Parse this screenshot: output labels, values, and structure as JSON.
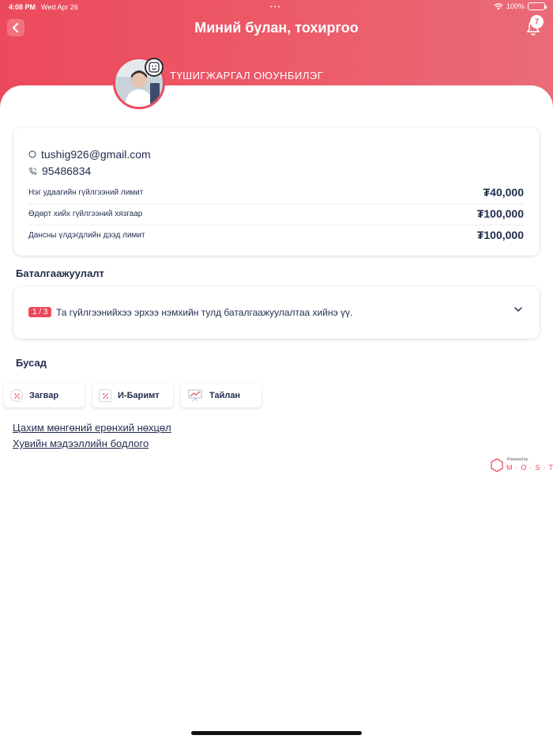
{
  "status_bar": {
    "time": "4:08 PM",
    "date": "Wed Apr 26",
    "battery": "100%"
  },
  "header": {
    "title": "Миний булан, тохиргоо",
    "notification_count": "7"
  },
  "profile": {
    "name": "ТҮШИГЖАРГАЛ ОЮУНБИЛЭГ"
  },
  "contact": {
    "email": "tushig926@gmail.com",
    "phone": "95486834"
  },
  "limits": [
    {
      "label": "Нэг удаагийн гүйлгээний лимит",
      "value": "₮40,000"
    },
    {
      "label": "Өдөрт хийх гүйлгээний хязгаар",
      "value": "₮100,000"
    },
    {
      "label": "Дансны үлдэгдлийн дээд лимит",
      "value": "₮100,000"
    }
  ],
  "verification": {
    "section_title": "Баталгаажуулалт",
    "step": "1 / 3",
    "message": "Та гүйлгээнийхээ эрхээ нэмхийн тулд баталгаажуулалтаа хийнэ үү."
  },
  "other": {
    "section_title": "Бусад",
    "buttons": [
      {
        "label": "Загвар",
        "icon": "percent-icon"
      },
      {
        "label": "И-Баримт",
        "icon": "receipt-icon"
      },
      {
        "label": "Тайлан",
        "icon": "report-chart-icon"
      }
    ]
  },
  "links": [
    "Цахим мөнгөний ерөнхий нөхцөл",
    "Хувийн мэдээллийн бодлого"
  ],
  "footer": {
    "powered_by": "Powered by",
    "brand": "M·O·S·T"
  },
  "colors": {
    "accent": "#ec4a5c",
    "text": "#1f2d4d"
  }
}
